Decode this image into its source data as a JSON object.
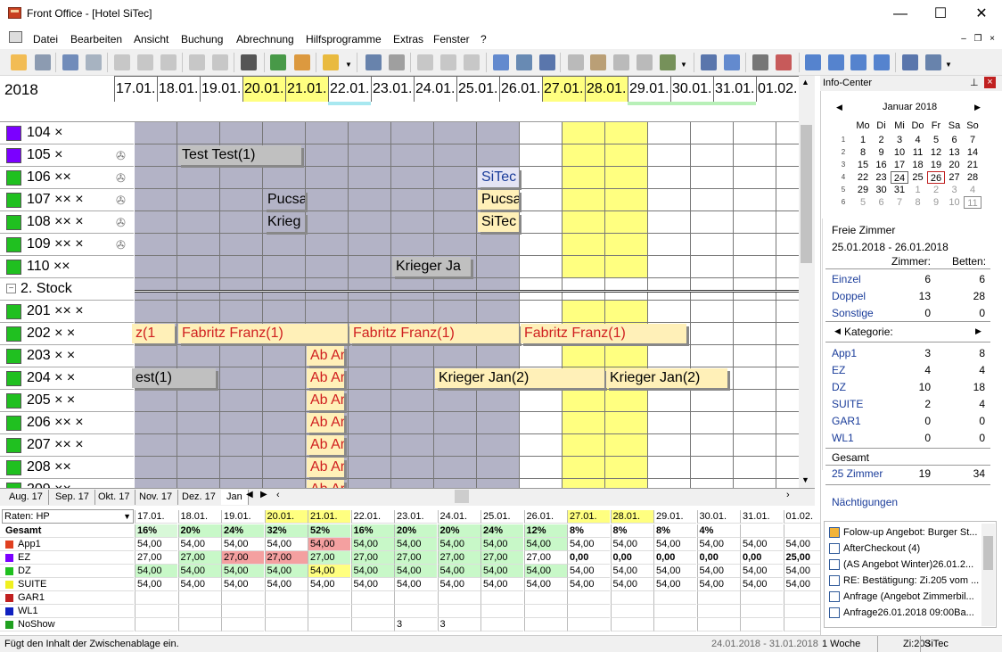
{
  "window": {
    "title": "Front Office - [Hotel SiTec]",
    "minimize": "—",
    "maximize": "☐",
    "close": "✕"
  },
  "menu": [
    "Datei",
    "Bearbeiten",
    "Ansicht",
    "Buchung",
    "Abrechnung",
    "Hilfsprogramme",
    "Extras",
    "Fenster",
    "?"
  ],
  "planner": {
    "year": "2018",
    "dates": [
      "17.01.",
      "18.01.",
      "19.01.",
      "20.01.",
      "21.01.",
      "22.01.",
      "23.01.",
      "24.01.",
      "25.01.",
      "26.01.",
      "27.01.",
      "28.01.",
      "29.01.",
      "30.01.",
      "31.01.",
      "01.02."
    ],
    "rooms": [
      {
        "label": "104 ×",
        "color": "#7b00ff"
      },
      {
        "label": "105 ×",
        "color": "#7b00ff"
      },
      {
        "label": "106 ××",
        "color": "#20c020"
      },
      {
        "label": "107 ×× ×",
        "color": "#20c020"
      },
      {
        "label": "108 ×× ×",
        "color": "#20c020"
      },
      {
        "label": "109 ×× ×",
        "color": "#20c020"
      },
      {
        "label": "110 ××",
        "color": "#20c020"
      },
      {
        "label": "2. Stock",
        "color": ""
      },
      {
        "label": "201 ×× ×",
        "color": "#20c020"
      },
      {
        "label": "202 × ×",
        "color": "#20c020"
      },
      {
        "label": "203 × ×",
        "color": "#20c020"
      },
      {
        "label": "204 × ×",
        "color": "#20c020"
      },
      {
        "label": "205 × ×",
        "color": "#20c020"
      },
      {
        "label": "206 ×× ×",
        "color": "#20c020"
      },
      {
        "label": "207 ×× ×",
        "color": "#20c020"
      },
      {
        "label": "208 ××",
        "color": "#20c020"
      },
      {
        "label": "209 ××",
        "color": "#20c020"
      }
    ],
    "bookings": [
      {
        "text": "Test Test(1)"
      },
      {
        "text": "SiTec"
      },
      {
        "text": "Pucsa"
      },
      {
        "text": "Pucsa"
      },
      {
        "text": "Krieg"
      },
      {
        "text": "SiTec"
      },
      {
        "text": "Krieger Ja"
      },
      {
        "text": "z(1"
      },
      {
        "text": "Fabritz Franz(1)"
      },
      {
        "text": "Fabritz Franz(1)"
      },
      {
        "text": "Fabritz Franz(1)"
      },
      {
        "text": "Ab Ar"
      },
      {
        "text": "est(1)"
      },
      {
        "text": "Ab Ar"
      },
      {
        "text": "Krieger Jan(2)"
      },
      {
        "text": "Krieger Jan(2)"
      },
      {
        "text": "Ab Ar"
      },
      {
        "text": "Ab Ar"
      },
      {
        "text": "Ab Ar"
      },
      {
        "text": "Ab Ar"
      },
      {
        "text": "Ab Ar"
      }
    ],
    "tabs": [
      "Aug. 17",
      "Sep. 17",
      "Okt. 17",
      "Nov. 17",
      "Dez. 17",
      "Jan"
    ]
  },
  "rates": {
    "selector": "Raten: HP",
    "rows": [
      {
        "name": "Gesamt",
        "color": "",
        "values": [
          "16%",
          "20%",
          "24%",
          "32%",
          "52%",
          "16%",
          "20%",
          "20%",
          "24%",
          "12%",
          "8%",
          "8%",
          "8%",
          "4%",
          "",
          ""
        ]
      },
      {
        "name": "App1",
        "color": "#e04020",
        "values": [
          "54,00",
          "54,00",
          "54,00",
          "54,00",
          "54,00",
          "54,00",
          "54,00",
          "54,00",
          "54,00",
          "54,00",
          "54,00",
          "54,00",
          "54,00",
          "54,00",
          "54,00",
          "54,00"
        ]
      },
      {
        "name": "EZ",
        "color": "#7b00ff",
        "values": [
          "27,00",
          "27,00",
          "27,00",
          "27,00",
          "27,00",
          "27,00",
          "27,00",
          "27,00",
          "27,00",
          "27,00",
          "0,00",
          "0,00",
          "0,00",
          "0,00",
          "0,00",
          "25,00"
        ]
      },
      {
        "name": "DZ",
        "color": "#20c020",
        "values": [
          "54,00",
          "54,00",
          "54,00",
          "54,00",
          "54,00",
          "54,00",
          "54,00",
          "54,00",
          "54,00",
          "54,00",
          "54,00",
          "54,00",
          "54,00",
          "54,00",
          "54,00",
          "54,00"
        ]
      },
      {
        "name": "SUITE",
        "color": "#f0f020",
        "values": [
          "54,00",
          "54,00",
          "54,00",
          "54,00",
          "54,00",
          "54,00",
          "54,00",
          "54,00",
          "54,00",
          "54,00",
          "54,00",
          "54,00",
          "54,00",
          "54,00",
          "54,00",
          "54,00"
        ]
      },
      {
        "name": "GAR1",
        "color": "#c02020",
        "values": [
          "",
          "",
          "",
          "",
          "",
          "",
          "",
          "",
          "",
          "",
          "",
          "",
          "",
          "",
          "",
          ""
        ]
      },
      {
        "name": "WL1",
        "color": "#1020c0",
        "values": [
          "",
          "",
          "",
          "",
          "",
          "",
          "",
          "",
          "",
          "",
          "",
          "",
          "",
          "",
          "",
          ""
        ]
      },
      {
        "name": "NoShow",
        "color": "#20a020",
        "values": [
          "",
          "",
          "",
          "",
          "",
          "",
          "3",
          "3",
          "",
          "",
          "",
          "",
          "",
          "",
          "",
          ""
        ]
      }
    ]
  },
  "statusbar": {
    "hint": "Fügt den Inhalt der Zwischenablage ein.",
    "range": "24.01.2018 - 31.01.2018",
    "duration": "1 Woche",
    "room": "Zi:203",
    "user": "SiTec"
  },
  "info": {
    "title": "Info-Center",
    "month": "Januar 2018",
    "weekdays": [
      "Mo",
      "Di",
      "Mi",
      "Do",
      "Fr",
      "Sa",
      "So"
    ],
    "weeks": [
      {
        "wk": "1",
        "days": [
          "1",
          "2",
          "3",
          "4",
          "5",
          "6",
          "7"
        ]
      },
      {
        "wk": "2",
        "days": [
          "8",
          "9",
          "10",
          "11",
          "12",
          "13",
          "14"
        ]
      },
      {
        "wk": "3",
        "days": [
          "15",
          "16",
          "17",
          "18",
          "19",
          "20",
          "21"
        ]
      },
      {
        "wk": "4",
        "days": [
          "22",
          "23",
          "24",
          "25",
          "26",
          "27",
          "28"
        ]
      },
      {
        "wk": "5",
        "days": [
          "29",
          "30",
          "31",
          "1",
          "2",
          "3",
          "4"
        ]
      },
      {
        "wk": "6",
        "days": [
          "5",
          "6",
          "7",
          "8",
          "9",
          "10",
          "11"
        ]
      }
    ],
    "free_title": "Freie Zimmer",
    "free_range": "25.01.2018 - 26.01.2018",
    "col_rooms": "Zimmer:",
    "col_beds": "Betten:",
    "types": [
      {
        "name": "Einzel",
        "rooms": "6",
        "beds": "6"
      },
      {
        "name": "Doppel",
        "rooms": "13",
        "beds": "28"
      },
      {
        "name": "Sonstige",
        "rooms": "0",
        "beds": "0"
      }
    ],
    "category_label": "Kategorie:",
    "categories": [
      {
        "name": "App1",
        "rooms": "3",
        "beds": "8"
      },
      {
        "name": "EZ",
        "rooms": "4",
        "beds": "4"
      },
      {
        "name": "DZ",
        "rooms": "10",
        "beds": "18"
      },
      {
        "name": "SUITE",
        "rooms": "2",
        "beds": "4"
      },
      {
        "name": "GAR1",
        "rooms": "0",
        "beds": "0"
      },
      {
        "name": "WL1",
        "rooms": "0",
        "beds": "0"
      }
    ],
    "total_label": "Gesamt",
    "total": {
      "name": "25 Zimmer",
      "rooms": "19",
      "beds": "34"
    },
    "nights": "Nächtigungen",
    "messages": [
      "Folow-up Angebot: Burger St...",
      "AfterCheckout (4)",
      "(AS Angebot Winter)26.01.2...",
      "RE: Bestätigung: Zi.205 vom ...",
      "Anfrage (Angebot Zimmerbil...",
      "Anfrage26.01.2018 09:00Ba..."
    ]
  },
  "colors": {
    "weekend": "#ffff80",
    "past": "#b3b3c6",
    "booking_gray": "#c0c0c0",
    "booking_yellow": "#fff0b8",
    "red_text": "#d02020"
  }
}
